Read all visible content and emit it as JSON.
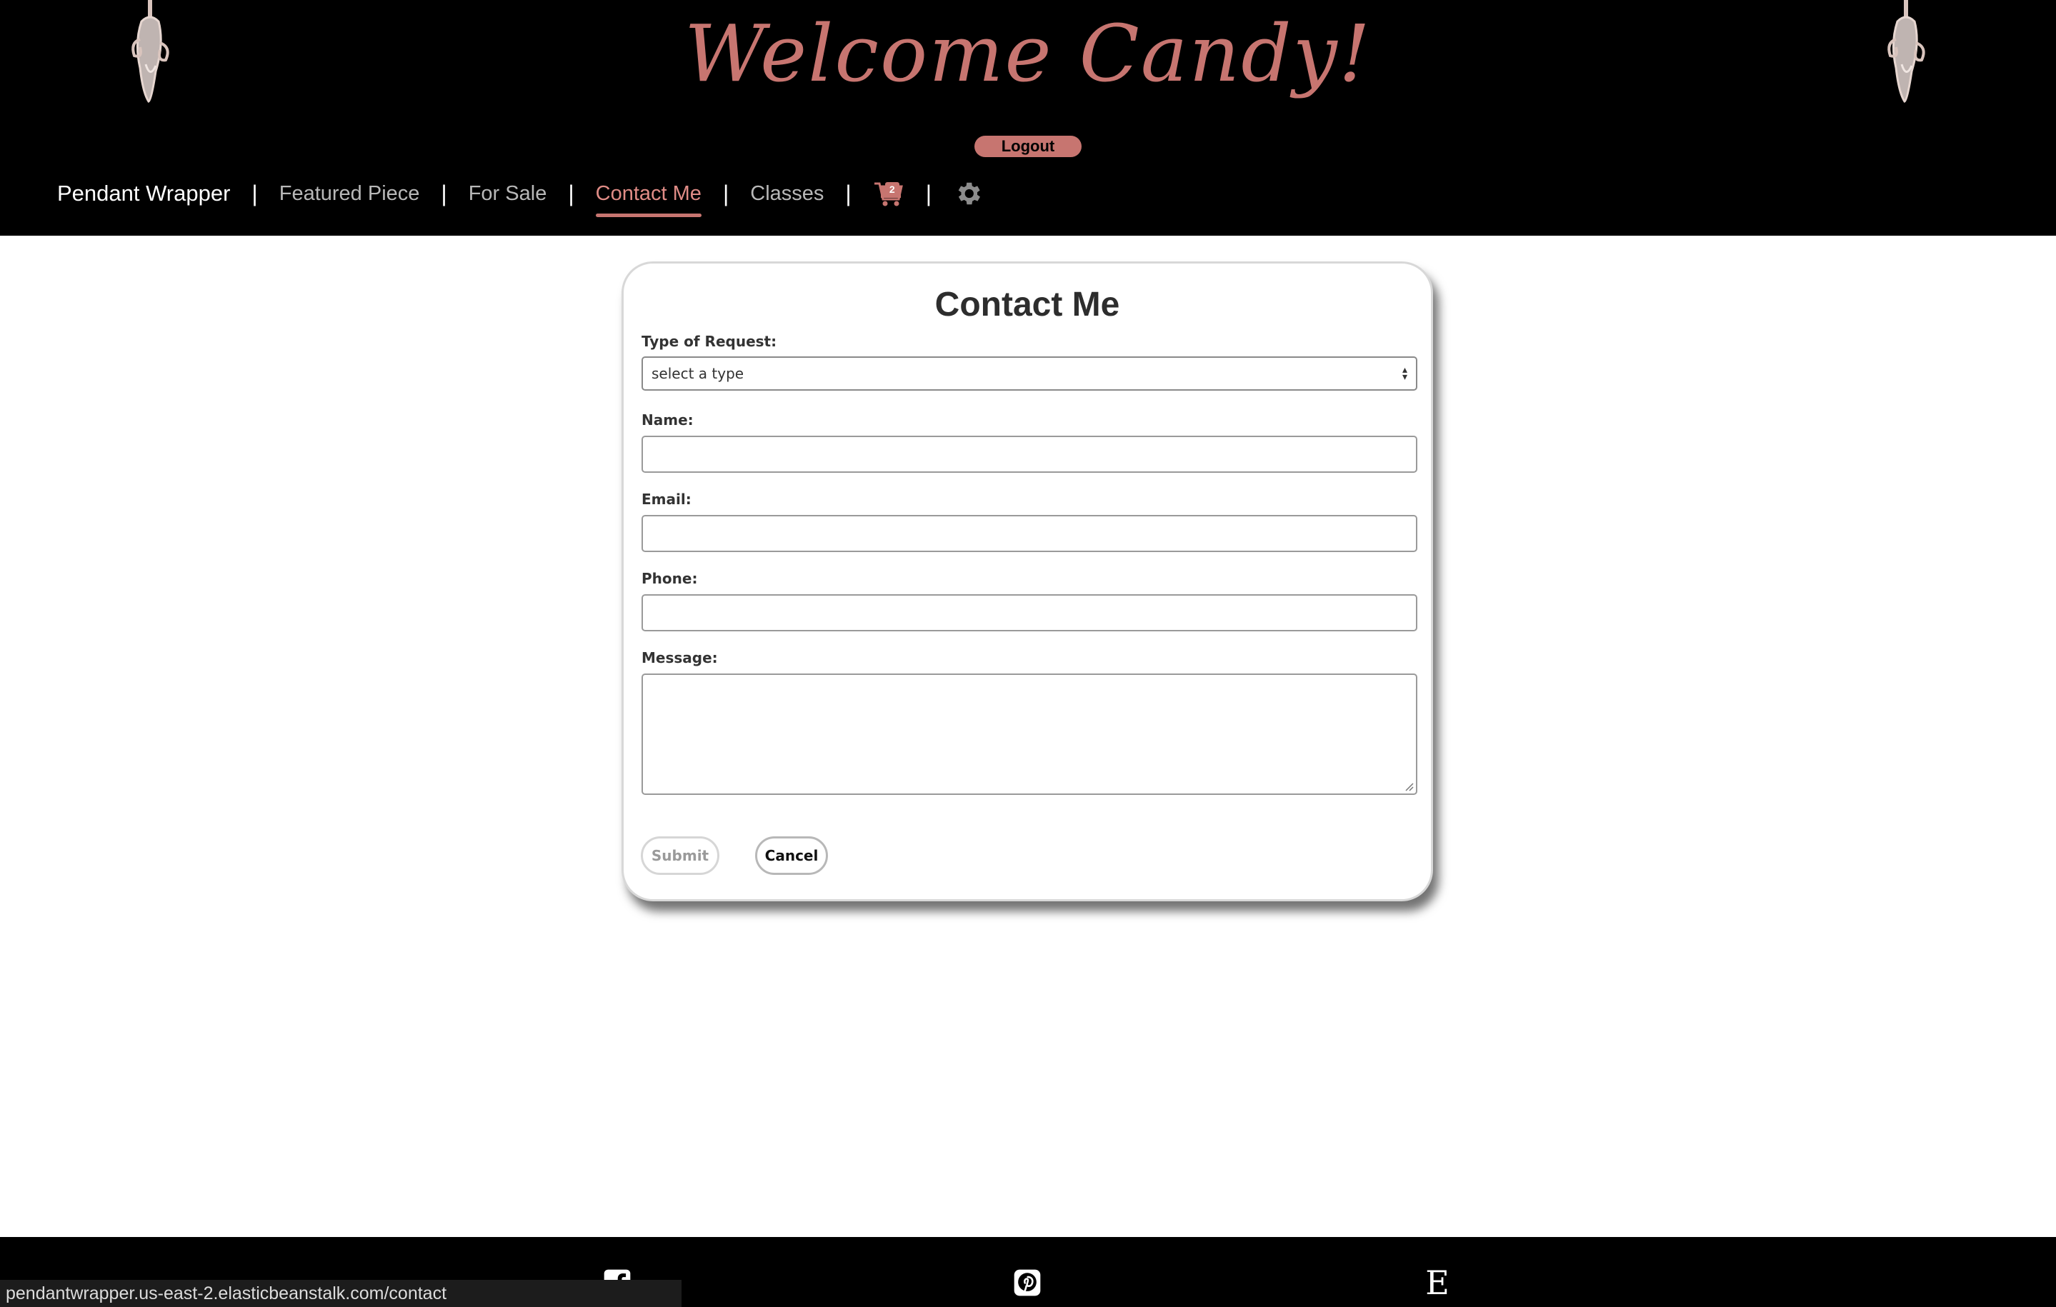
{
  "header": {
    "welcome_text": "Welcome Candy!",
    "logout_label": "Logout"
  },
  "nav": {
    "brand": "Pendant Wrapper",
    "links": [
      "Featured Piece",
      "For Sale",
      "Contact Me",
      "Classes"
    ],
    "active": "Contact Me",
    "separator": "|",
    "cart_count": "2",
    "icons": [
      "cart-icon",
      "gear-icon"
    ]
  },
  "form": {
    "title": "Contact Me",
    "type_label": "Type of Request:",
    "type_value": "select a type",
    "name_label": "Name:",
    "name_value": "",
    "email_label": "Email:",
    "email_value": "",
    "phone_label": "Phone:",
    "phone_value": "",
    "message_label": "Message:",
    "message_value": "",
    "submit_label": "Submit",
    "cancel_label": "Cancel"
  },
  "footer": {
    "icons": [
      "facebook-icon",
      "pinterest-icon",
      "etsy-icon"
    ],
    "etsy_glyph": "E"
  },
  "status_url": "pendantwrapper.us-east-2.elasticbeanstalk.com/contact",
  "colors": {
    "accent": "#c77570",
    "active_link": "#e08c86",
    "header_bg": "#000000"
  }
}
